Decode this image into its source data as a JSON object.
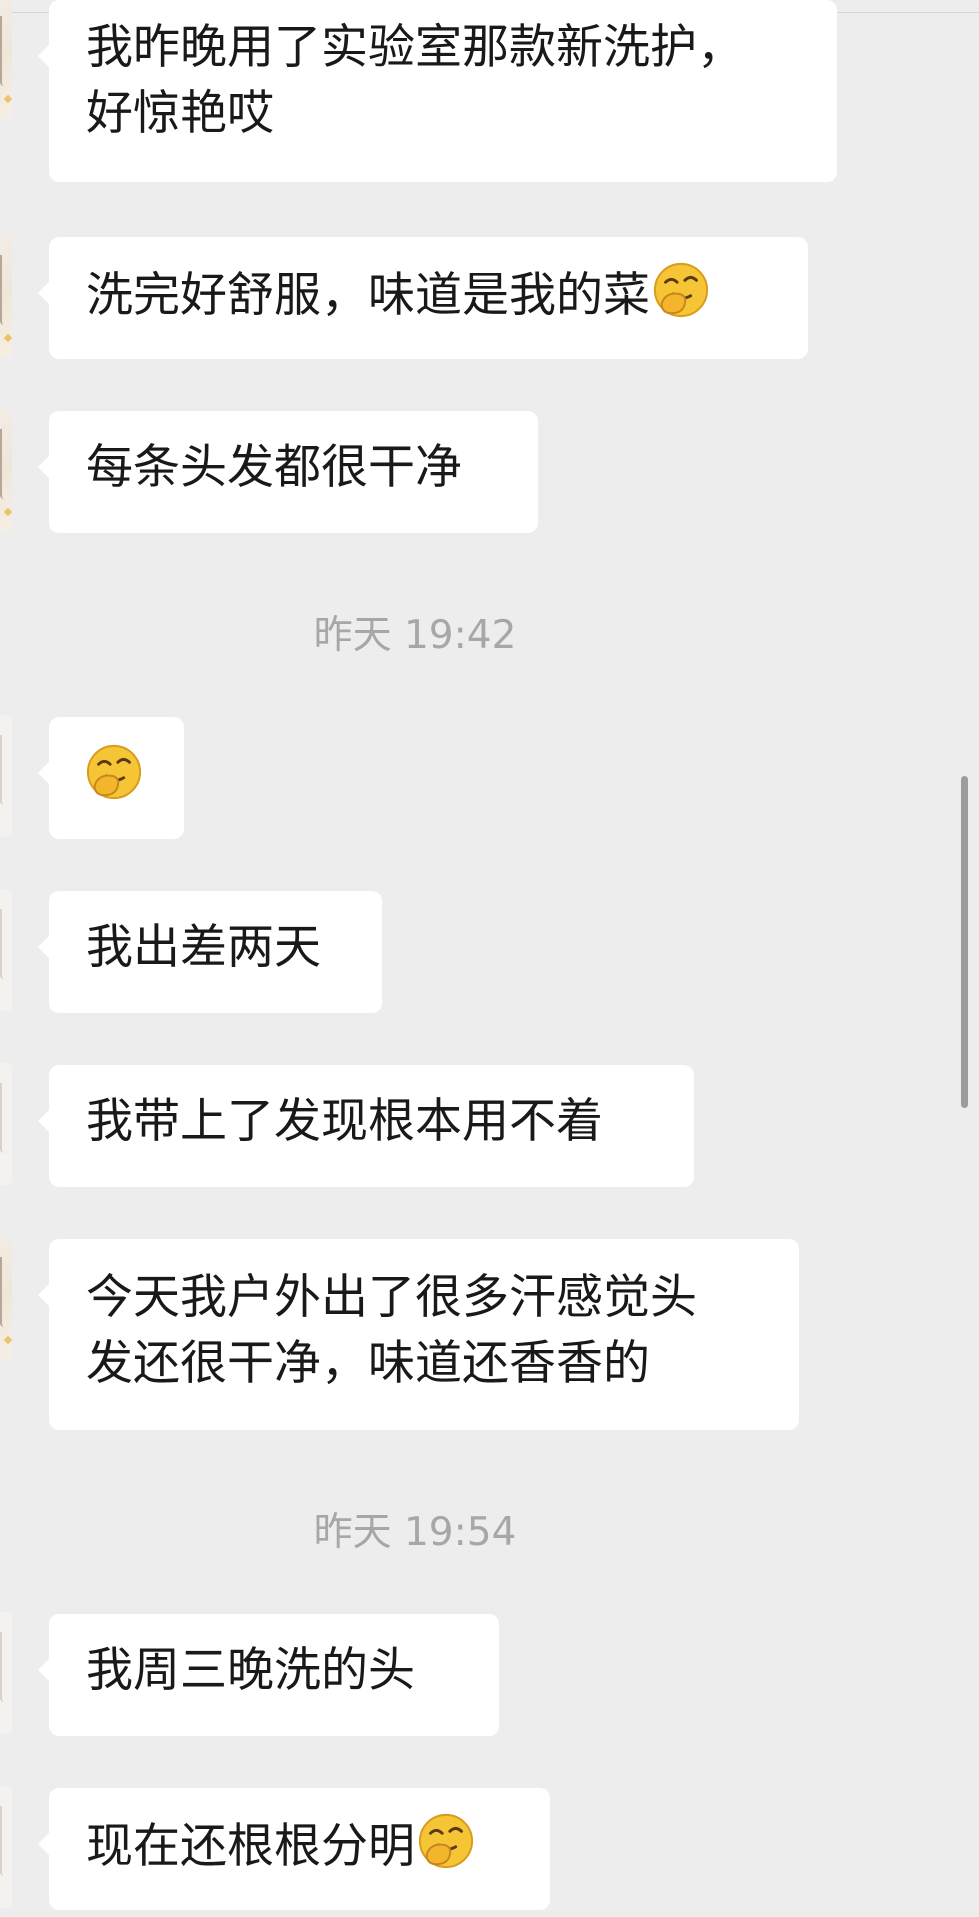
{
  "messages": [
    {
      "lines": [
        "我昨晚用了实验室那款新洗护，",
        "好惊艳哎"
      ],
      "emoji": false,
      "avatar": "character"
    },
    {
      "lines": [
        "洗完好舒服，味道是我的菜"
      ],
      "emoji": true,
      "avatar": "character"
    },
    {
      "lines": [
        "每条头发都很干净"
      ],
      "emoji": false,
      "avatar": "character"
    },
    {
      "lines": [],
      "emoji": true,
      "avatar": "plain"
    },
    {
      "lines": [
        "我出差两天"
      ],
      "emoji": false,
      "avatar": "plain"
    },
    {
      "lines": [
        "我带上了发现根本用不着"
      ],
      "emoji": false,
      "avatar": "plain"
    },
    {
      "lines": [
        "今天我户外出了很多汗感觉头",
        "发还很干净，味道还香香的"
      ],
      "emoji": false,
      "avatar": "character"
    },
    {
      "lines": [
        "我周三晚洗的头"
      ],
      "emoji": false,
      "avatar": "plain"
    },
    {
      "lines": [
        "现在还根根分明"
      ],
      "emoji": true,
      "avatar": "plain"
    }
  ],
  "timestamps": [
    "昨天 19:42",
    "昨天 19:54"
  ],
  "emoji_icon": "shy-smile-emoji-icon",
  "colors": {
    "background": "#ededed",
    "bubble": "#ffffff",
    "text": "#191919",
    "timestamp": "#a7a7a7",
    "scrollbar": "#9c9c9c"
  }
}
